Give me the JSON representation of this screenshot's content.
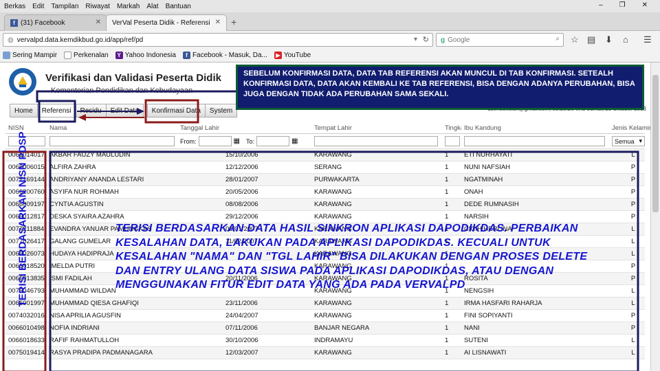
{
  "browser": {
    "menu": [
      "Berkas",
      "Edit",
      "Tampilan",
      "Riwayat",
      "Markah",
      "Alat",
      "Bantuan"
    ],
    "tabs": [
      {
        "label": "(31) Facebook"
      },
      {
        "label": "VerVal Peserta Didik - Referensi"
      }
    ],
    "new_tab": "+",
    "url": "vervalpd.data.kemdikbud.go.id/app/ref/pd",
    "search_placeholder": "Google",
    "bookmarks": [
      "Sering Mampir",
      "Perkenalan",
      "Yahoo Indonesia",
      "Facebook - Masuk, Da...",
      "YouTube"
    ],
    "win_controls": [
      "–",
      "❐",
      "✕"
    ]
  },
  "app": {
    "title": "Verifikasi dan Validasi Peserta Didik",
    "subtitle": "Kementerian Pendidikan dan Kebudayaan",
    "tabs": [
      "Home",
      "Referensi",
      "Residu",
      "Edit Data",
      "Konfirmasi Data",
      "System"
    ],
    "user_info": "user:sekolah@gmail.com, 03:20:26 WIB Jumat, 25 Oktober 2013"
  },
  "grid": {
    "headers": [
      "NISN",
      "Nama",
      "Tanggal Lahir",
      "Tempat Lahir",
      "Tingkat",
      "Ibu Kandung",
      "Jenis Kelamin"
    ],
    "filter_from": "From:",
    "filter_to": "To:",
    "gender_filter": "Semua",
    "rows": [
      [
        "0061014017",
        "AKBAR FAUZY MAULUDIN",
        "15/10/2006",
        "KARAWANG",
        "1",
        "ETI NURHAYATI",
        "L"
      ],
      [
        "0066006015",
        "ALFIRA ZAHRA",
        "12/12/2006",
        "SERANG",
        "1",
        "NUNI NAFSIAH",
        "P"
      ],
      [
        "0077169144",
        "ANDRIYANY ANANDA LESTARI",
        "28/01/2007",
        "PURWAKARTA",
        "1",
        "NGATMINAH",
        "P"
      ],
      [
        "0066200760",
        "ASYIFA NUR ROHMAH",
        "20/05/2006",
        "KARAWANG",
        "1",
        "ONAH",
        "P"
      ],
      [
        "0066009197",
        "CYNTIA AGUSTIN",
        "08/08/2006",
        "KARAWANG",
        "1",
        "DEDE RUMNASIH",
        "P"
      ],
      [
        "0066012817",
        "DESKA SYAIRA AZAHRA",
        "29/12/2006",
        "KARAWANG",
        "1",
        "NARSIH",
        "P"
      ],
      [
        "0077211884",
        "EVANDRA YANUAR PAMUNGKAS",
        "02/01/2007",
        "KARAWANG",
        "1",
        "CICIH HERLINA",
        "L"
      ],
      [
        "0077026417",
        "GALANG GUMELAR",
        "11/02/2007",
        "KARAWANG",
        "1",
        "",
        "L"
      ],
      [
        "0066026073",
        "HUDAYA HADIPRAJA",
        "",
        "KARAWANG",
        "1",
        "",
        "L"
      ],
      [
        "0066018520",
        "IMELDA PUTRI",
        "",
        "KARAWANG",
        "1",
        "",
        "P"
      ],
      [
        "0066013835",
        "ISMI FADILAH",
        "20/11/2006",
        "KARAWANG",
        "1",
        "ROSITA",
        "P"
      ],
      [
        "0076046793",
        "MUHAMMAD WILDAN",
        "",
        "KARAWANG",
        "1",
        "NENGSIH",
        "L"
      ],
      [
        "0066001997",
        "MUHAMMAD QIESA GHAFIQI",
        "23/11/2006",
        "KARAWANG",
        "1",
        "IRMA HASFARI RAHARJA",
        "L"
      ],
      [
        "0074032016",
        "NISA APRILIA AGUSFIN",
        "24/04/2007",
        "KARAWANG",
        "1",
        "FINI SOPIYANTI",
        "P"
      ],
      [
        "0066010498",
        "NOFIA INDRIANI",
        "07/11/2006",
        "BANJAR NEGARA",
        "1",
        "NANI",
        "P"
      ],
      [
        "0066018633",
        "RAFIF RAHMATULLOH",
        "30/10/2006",
        "INDRAMAYU",
        "1",
        "SUTENI",
        "L"
      ],
      [
        "0075019414",
        "RASYA PRADIPA PADMANAGARA",
        "12/03/2007",
        "KARAWANG",
        "1",
        "AI LISNAWATI",
        "L"
      ]
    ]
  },
  "notes": {
    "top": "SEBELUM KONFIRMASI DATA, DATA TAB REFERENSI AKAN MUNCUL DI TAB KONFIRMASI. SETEALH KONFIRMASI DATA, DATA AKAN KEMBALI KE TAB REFERENSI, BISA DENGAN ADANYA PERUBAHAN, BISA JUGA DENGAN TIDAK ADA PERUBAHAN SAMA SEKALI.",
    "middle": "TERISI BERDASARKAN DATA HASIL SINKRON APLIKASI DAPODIKDAS. PERBAIKAN KESALAHAN DATA, LAKUKAN PADA APLIKASI DAPODIKDAS. KECUALI UNTUK KESALAHAN \"NAMA\" DAN \"TGL LAHIR\" BISA DILAKUKAN DENGAN PROSES DELETE DAN ENTRY ULANG DATA SISWA PADA APLIKASI DAPODIKDAS, ATAU DENGAN MENGGUNAKAN FITUR EDIT DATA YANG ADA PADA VERVALPD",
    "vertical": "TERISI BERDASARKAN NISN PDSP"
  },
  "colors": {
    "accent_blue": "#1414d0",
    "note_bg": "#111d6f",
    "note_border": "#0c5a34",
    "box_red": "#8b1a1a",
    "box_navy": "#1b1b5e"
  }
}
